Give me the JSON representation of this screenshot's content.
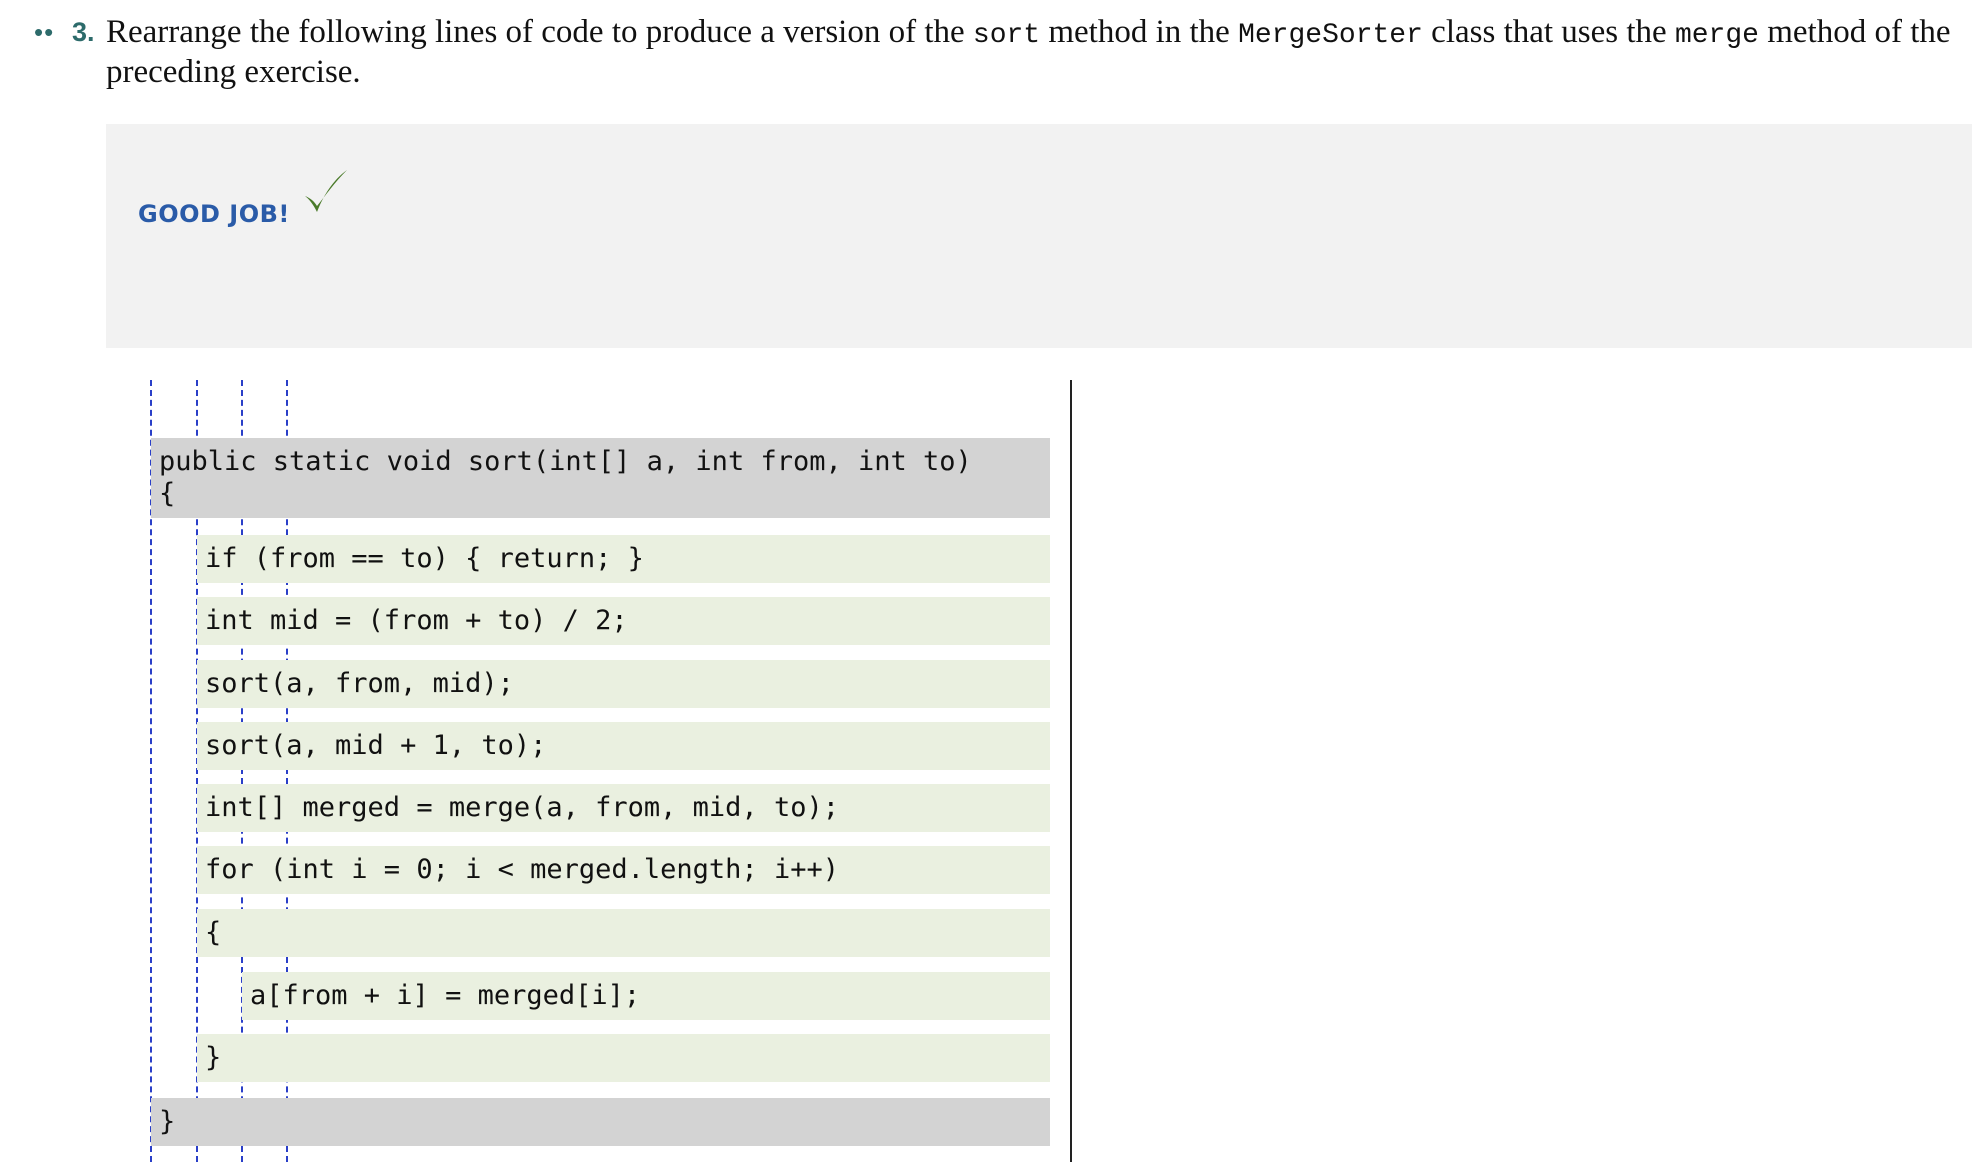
{
  "question": {
    "bullets": "••",
    "number": "3.",
    "text_parts": {
      "p1": "Rearrange the following lines of code to produce a version of the ",
      "code1": "sort",
      "p2": " method in the ",
      "code2": "MergeSorter",
      "p3": " class that uses the ",
      "code3": "merge",
      "p4": " method of the preceding exercise."
    }
  },
  "feedback": {
    "message": "GOOD JOB!",
    "icon": "checkmark-icon",
    "message_color": "#2a5ba8",
    "icon_color": "#4a7a2a"
  },
  "colors": {
    "fixed_tile": "#d3d3d3",
    "movable_tile": "#eaf0e0",
    "indent_guides": "#2a3fc8"
  },
  "code": {
    "header_line1": "public static void sort(int[] a, int from, int to)",
    "header_line2": "{",
    "lines": [
      "if (from == to) { return; }",
      "int mid = (from + to) / 2;",
      "sort(a, from, mid);",
      "sort(a, mid + 1, to);",
      "int[] merged = merge(a, from, mid, to);",
      "for (int i = 0; i < merged.length; i++)",
      "{",
      "a[from + i] = merged[i];",
      "}"
    ],
    "footer": "}"
  }
}
